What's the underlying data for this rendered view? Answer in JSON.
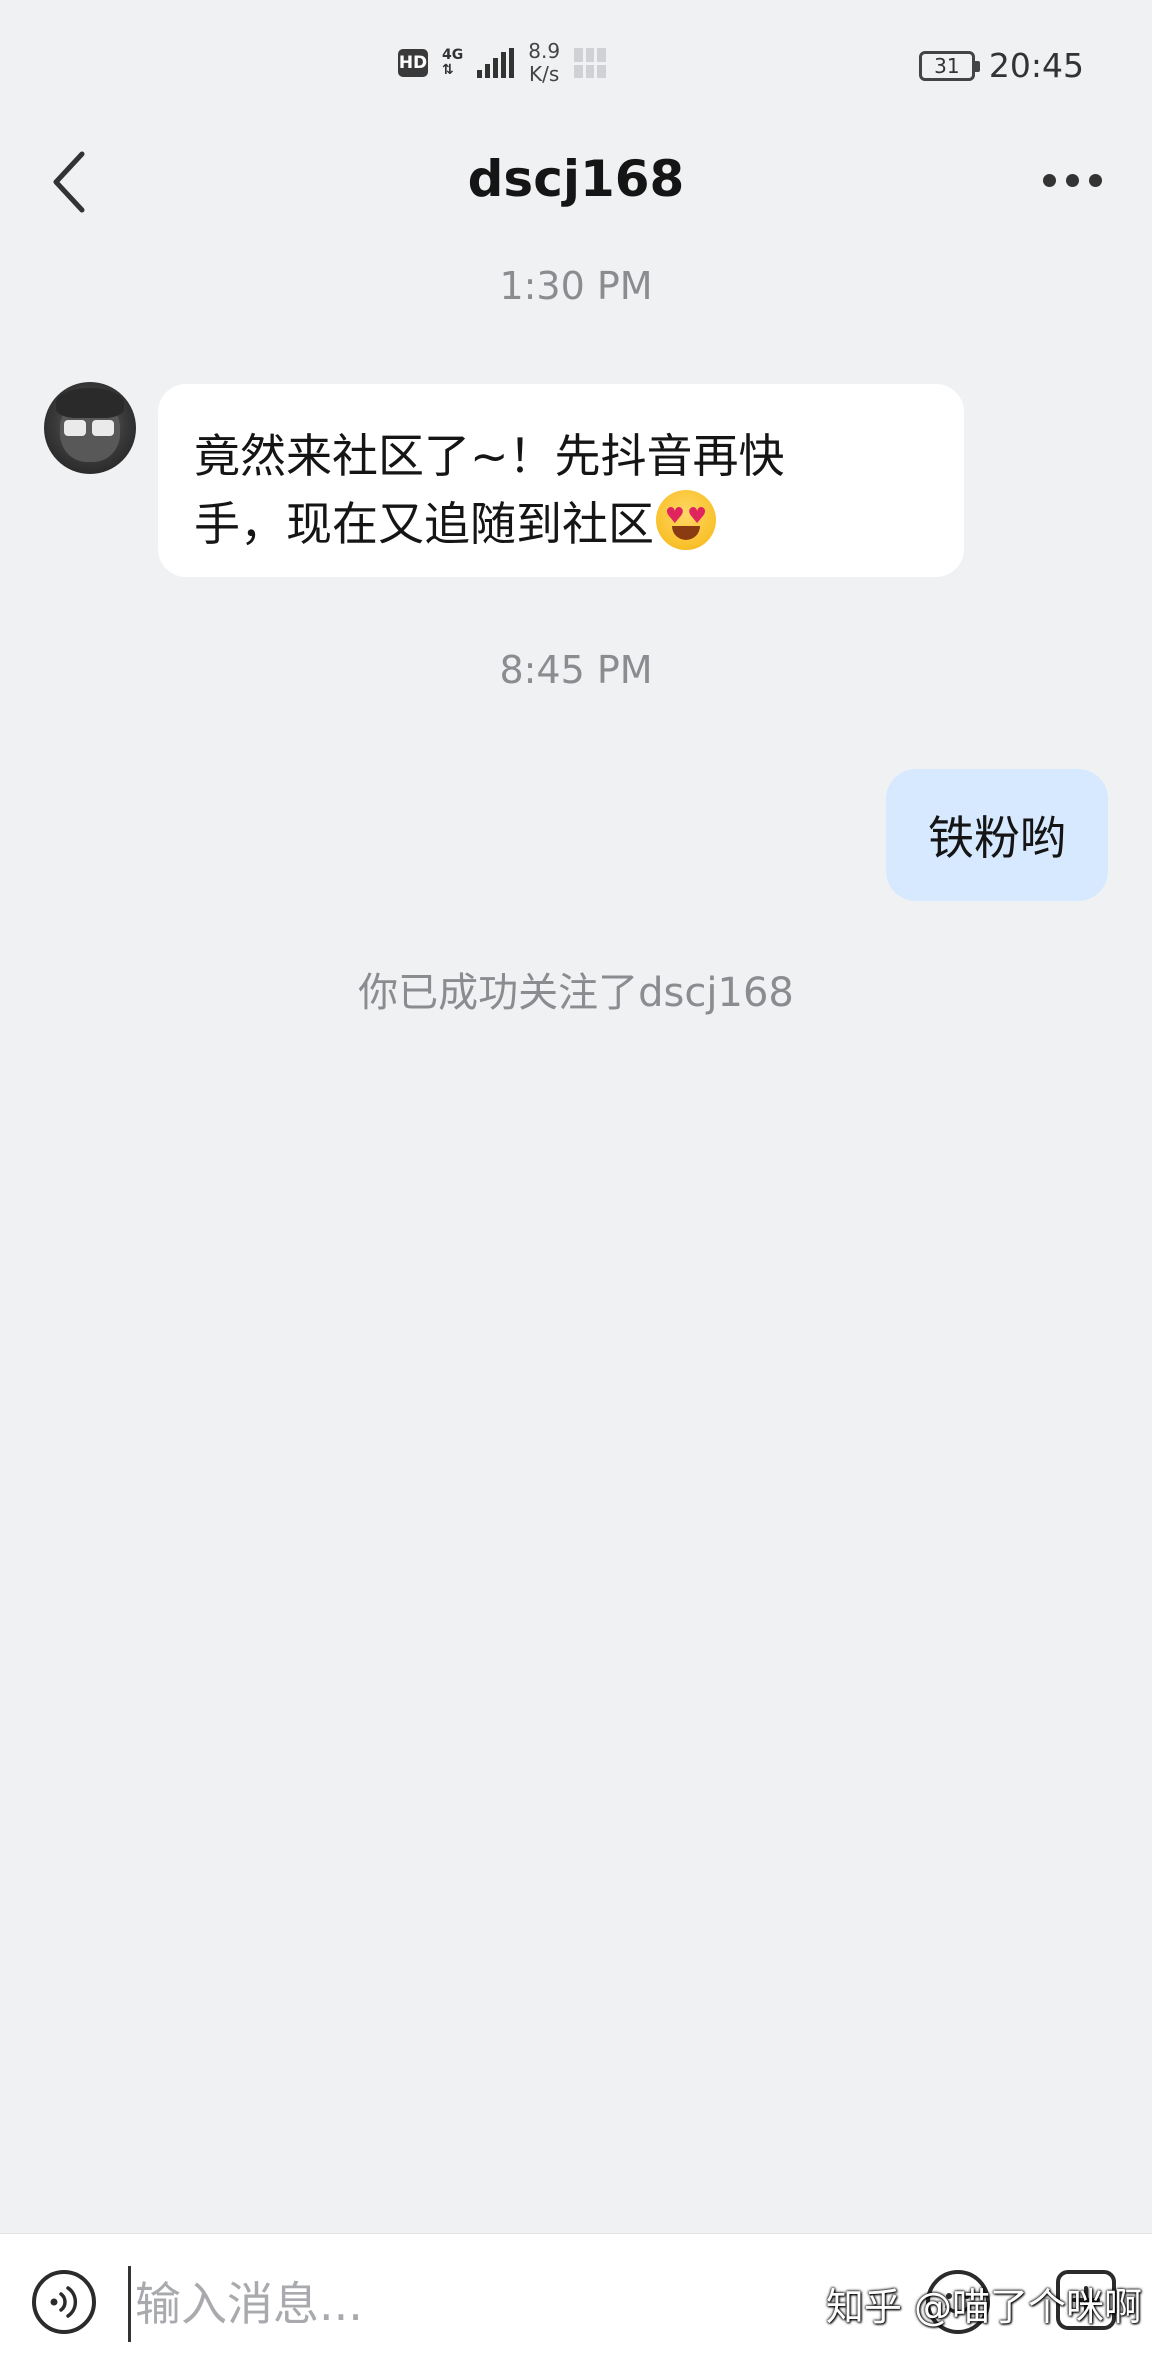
{
  "status_bar": {
    "hd": "HD",
    "network": "4G",
    "speed_value": "8.9",
    "speed_unit": "K/s",
    "battery": "31",
    "time": "20:45"
  },
  "header": {
    "title": "dscj168"
  },
  "messages": [
    {
      "timestamp": "1:30 PM",
      "direction": "incoming",
      "text_line1": "竟然来社区了~！先抖音再快",
      "text_line2": "手，现在又追随到社区",
      "emoji": "heart-eyes"
    },
    {
      "timestamp": "8:45 PM",
      "direction": "outgoing",
      "text": "铁粉哟"
    }
  ],
  "system_notice": "你已成功关注了dscj168",
  "input": {
    "placeholder": "输入消息..."
  },
  "watermark": "知乎 @喵了个咪啊",
  "colors": {
    "background": "#f0f1f3",
    "outgoing_bubble": "#d6e9ff",
    "incoming_bubble": "#ffffff"
  }
}
